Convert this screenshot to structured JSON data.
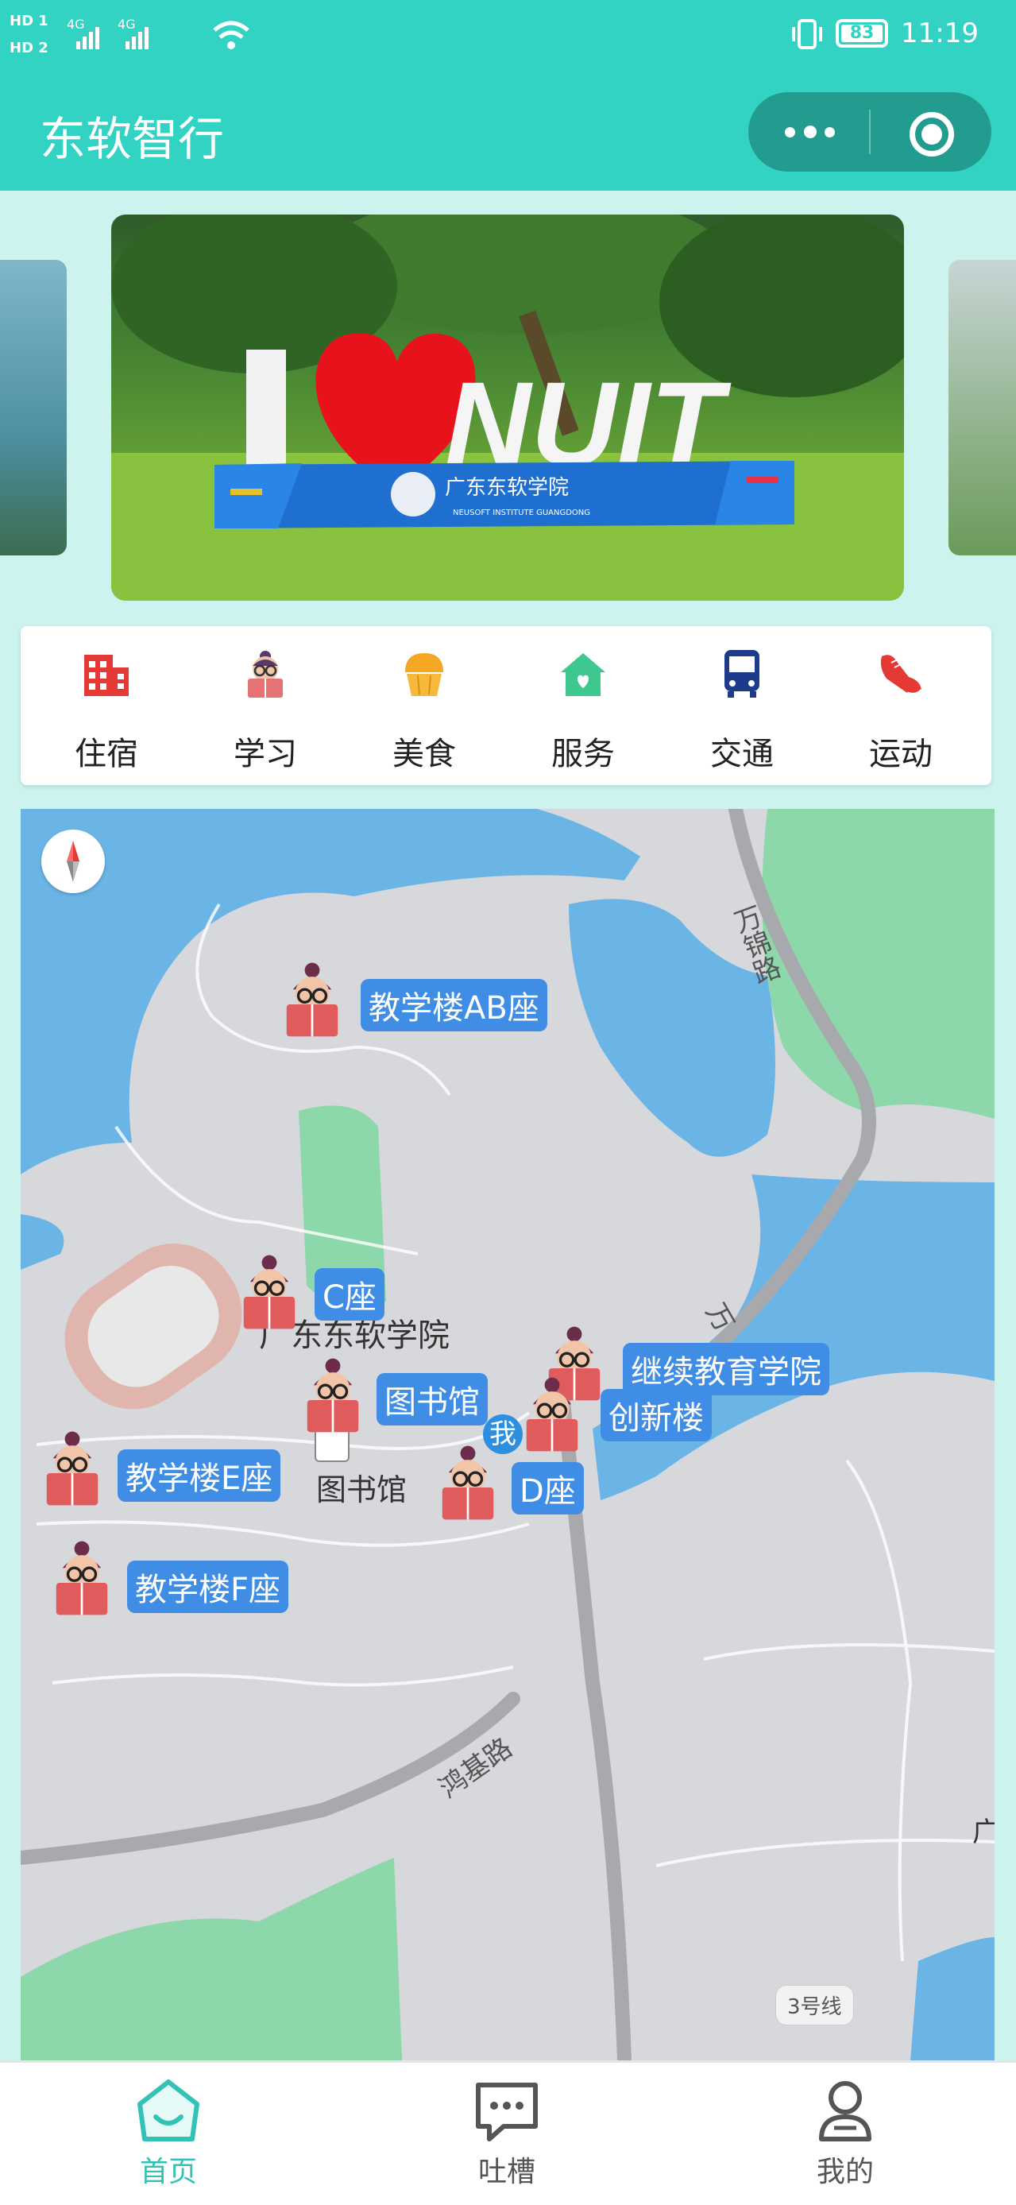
{
  "status_bar": {
    "hd1": "HD 1",
    "hd2": "HD 2",
    "signal1": "4G",
    "signal2": "4G",
    "battery": "83",
    "time": "11:19"
  },
  "header": {
    "title": "东软智行",
    "more_icon": "more-dots-icon",
    "close_icon": "target-icon"
  },
  "banner": {
    "sign_left": "I",
    "sign_right": "NUIT",
    "sign_cn": "广东东软学院",
    "sign_en": "NEUSOFT INSTITUTE GUANGDONG"
  },
  "categories": [
    {
      "label": "住宿",
      "icon": "building-icon",
      "color": "#e53935"
    },
    {
      "label": "学习",
      "icon": "reading-student-icon",
      "color": "#e57373"
    },
    {
      "label": "美食",
      "icon": "cupcake-icon",
      "color": "#f5a623"
    },
    {
      "label": "服务",
      "icon": "home-heart-icon",
      "color": "#3ec88f"
    },
    {
      "label": "交通",
      "icon": "bus-icon",
      "color": "#1e3a8a"
    },
    {
      "label": "运动",
      "icon": "sneaker-icon",
      "color": "#e53935"
    }
  ],
  "map": {
    "campus_name": "广东东软学院",
    "library_poi": "图书馆",
    "me": "我",
    "road_wanjin": "万锦路",
    "road_wan": "万",
    "road_hongji": "鸿基路",
    "metro": "3号线",
    "edge_text": "广",
    "markers": [
      {
        "label": "教学楼AB座"
      },
      {
        "label": "C座"
      },
      {
        "label": "图书馆"
      },
      {
        "label": "继续教育学院"
      },
      {
        "label": "创新楼"
      },
      {
        "label": "D座"
      },
      {
        "label": "教学楼E座"
      },
      {
        "label": "教学楼F座"
      }
    ]
  },
  "tabbar": {
    "tabs": [
      {
        "label": "首页",
        "icon": "home-bag-icon",
        "active": true
      },
      {
        "label": "吐槽",
        "icon": "chat-bubble-icon",
        "active": false
      },
      {
        "label": "我的",
        "icon": "user-icon",
        "active": false
      }
    ],
    "active_color": "#33c3b6",
    "inactive_color": "#666666"
  }
}
